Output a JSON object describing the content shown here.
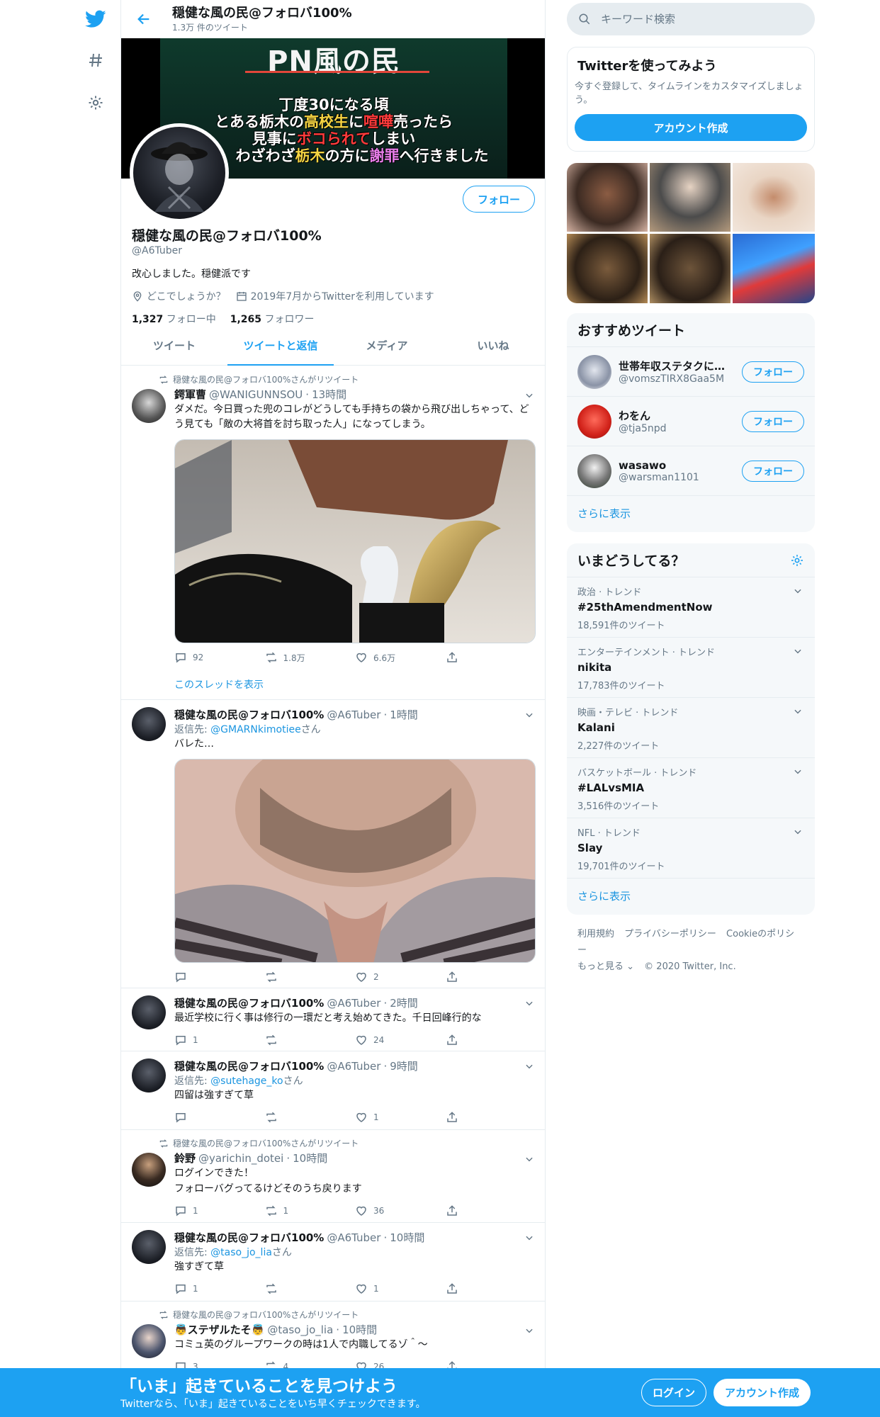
{
  "header": {
    "title": "穏健な風の民@フォロバ100%",
    "subtitle": "1.3万 件のツイート"
  },
  "banner": {
    "title": "PN風の民",
    "line1": "丁度30になる頃",
    "line2_a": "とある栃木の",
    "line2_b": "高校生",
    "line2_c": "に",
    "line2_d": "喧嘩",
    "line2_e": "売ったら",
    "line3_a": "見事に",
    "line3_b": "ボコられて",
    "line3_c": "しまい",
    "line4_a": "わざわざ",
    "line4_b": "栃木",
    "line4_c": "の方に",
    "line4_d": "謝罪",
    "line4_e": "へ行きました"
  },
  "profile": {
    "follow_label": "フォロー",
    "name": "穏健な風の民@フォロバ100%",
    "handle": "@A6Tuber",
    "bio": "改心しました。穏健派です",
    "location": "どこでしょうか？",
    "joined": "2019年7月からTwitterを利用しています",
    "following_count": "1,327",
    "following_label": "フォロー中",
    "followers_count": "1,265",
    "followers_label": "フォロワー"
  },
  "tabs": [
    "ツイート",
    "ツイートと返信",
    "メディア",
    "いいね"
  ],
  "tweets": {
    "t1": {
      "retweet_by": "穏健な風の民@フォロバ100%さんがリツイート",
      "name": "鍔軍曹",
      "handle": "@WANIGUNNSOU",
      "time": "13時間",
      "text": "ダメだ。今日買った兜のコレがどうしても手持ちの袋から飛び出しちゃって、どう見ても「敵の大将首を討ち取った人」になってしまう。",
      "replies": "92",
      "retweets": "1.8万",
      "likes": "6.6万",
      "show_thread": "このスレッドを表示"
    },
    "t2": {
      "name": "穏健な風の民@フォロバ100%",
      "handle": "@A6Tuber",
      "time": "1時間",
      "reply_prefix": "返信先: ",
      "reply_to": "@GMARNkimotiee",
      "reply_suffix": "さん",
      "text": "バレた…",
      "replies": "",
      "retweets": "",
      "likes": "2"
    },
    "t3": {
      "name": "穏健な風の民@フォロバ100%",
      "handle": "@A6Tuber",
      "time": "2時間",
      "text": "最近学校に行く事は修行の一環だと考え始めてきた。千日回峰行的な",
      "replies": "1",
      "retweets": "",
      "likes": "24"
    },
    "t4": {
      "name": "穏健な風の民@フォロバ100%",
      "handle": "@A6Tuber",
      "time": "9時間",
      "reply_prefix": "返信先: ",
      "reply_to": "@sutehage_ko",
      "reply_suffix": "さん",
      "text": "四留は強すぎて草",
      "replies": "",
      "retweets": "",
      "likes": "1"
    },
    "t5": {
      "retweet_by": "穏健な風の民@フォロバ100%さんがリツイート",
      "name": "鈴野",
      "handle": "@yarichin_dotei",
      "time": "10時間",
      "text1": "ログインできた！",
      "text2": "フォローバグってるけどそのうち戻ります",
      "replies": "1",
      "retweets": "1",
      "likes": "36"
    },
    "t6": {
      "name": "穏健な風の民@フォロバ100%",
      "handle": "@A6Tuber",
      "time": "10時間",
      "reply_prefix": "返信先: ",
      "reply_to": "@taso_jo_lia",
      "reply_suffix": "さん",
      "text": "強すぎて草",
      "replies": "1",
      "retweets": "",
      "likes": "1"
    },
    "t7": {
      "retweet_by": "穏健な風の民@フォロバ100%さんがリツイート",
      "name": "👼ステザルたそ👼",
      "handle": "@taso_jo_lia",
      "time": "10時間",
      "text": "コミュ英のグループワークの時は1人で内職してるゾ＾〜",
      "replies": "3",
      "retweets": "4",
      "likes": "26"
    }
  },
  "search": {
    "placeholder": "キーワード検索"
  },
  "signup_card": {
    "title": "Twitterを使ってみよう",
    "desc": "今すぐ登録して、タイムラインをカスタマイズしましょう。",
    "button": "アカウント作成"
  },
  "recommend": {
    "title": "おすすめツイート",
    "users": [
      {
        "name": "世帯年収ステタクに…",
        "handle": "@vomszTIRX8Gaa5M",
        "follow": "フォロー"
      },
      {
        "name": "わをん",
        "handle": "@tja5npd",
        "follow": "フォロー"
      },
      {
        "name": "wasawo",
        "handle": "@warsman1101",
        "follow": "フォロー"
      }
    ],
    "more": "さらに表示"
  },
  "trends": {
    "title": "いまどうしてる？",
    "items": [
      {
        "category": "政治 · トレンド",
        "name": "#25thAmendmentNow",
        "count": "18,591件のツイート"
      },
      {
        "category": "エンターテインメント · トレンド",
        "name": "nikita",
        "count": "17,783件のツイート"
      },
      {
        "category": "映画・テレビ · トレンド",
        "name": "Kalani",
        "count": "2,227件のツイート"
      },
      {
        "category": "バスケットボール · トレンド",
        "name": "#LALvsMIA",
        "count": "3,516件のツイート"
      },
      {
        "category": "NFL · トレンド",
        "name": "Slay",
        "count": "19,701件のツイート"
      }
    ],
    "more": "さらに表示"
  },
  "footer": {
    "terms": "利用規約",
    "privacy": "プライバシーポリシー",
    "cookie": "Cookieのポリシー",
    "more": "もっと見る ⌄",
    "copyright": "© 2020 Twitter, Inc."
  },
  "bottom_bar": {
    "title": "「いま」起きていることを見つけよう",
    "subtitle": "Twitterなら、「いま」起きていることをいち早くチェックできます。",
    "login": "ログイン",
    "signup": "アカウント作成"
  },
  "colors": {
    "accent": "#1da1f2",
    "secondary_text": "#657786",
    "border": "#e6ecf0",
    "panel": "#f5f8fa"
  }
}
